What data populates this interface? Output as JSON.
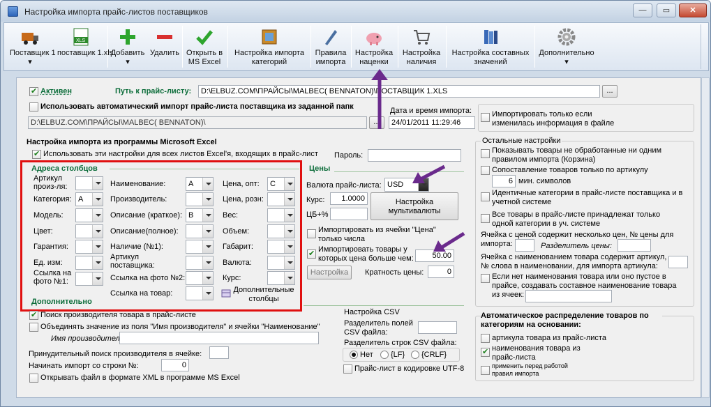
{
  "window": {
    "title": "Настройка импорта прайс-листов поставщиков"
  },
  "toolbar": {
    "supplier1": "Поставщик 1",
    "supplier2": "поставщик 1.xls",
    "add": "Добавить",
    "remove": "Удалить",
    "open_excel_1": "Открыть в",
    "open_excel_2": "MS Excel",
    "cat_import_1": "Настройка импорта",
    "cat_import_2": "категорий",
    "rules_1": "Правила",
    "rules_2": "импорта",
    "markup_1": "Настройка",
    "markup_2": "наценки",
    "avail_1": "Настройка",
    "avail_2": "наличия",
    "composite_1": "Настройка составных",
    "composite_2": "значений",
    "more": "Дополнительно"
  },
  "top": {
    "active_label": "Активен",
    "path_label": "Путь к прайс-листу:",
    "path_value": "D:\\ELBUZ.COM\\ПРАЙСЫ\\MALBEC( BENNATON)\\ПОСТАВЩИК 1.XLS",
    "browse": "...",
    "auto_import_label": "Использовать автоматический импорт прайс-листа поставщика из заданной папк",
    "auto_path": "D:\\ELBUZ.COM\\ПРАЙСЫ\\MALBEC( BENNATON)\\",
    "datetime_label": "Дата и время импорта:",
    "datetime_value": "24/01/2011 11:29:46",
    "only_if_changed": "Импортировать только если изменилась информация в файле"
  },
  "excel": {
    "title": "Настройка импорта из программы Microsoft Excel",
    "use_for_all": "Использовать эти настройки для всех листов Excel'я, входящих в прайс-лист",
    "password_label": "Пароль:"
  },
  "columns": {
    "title": "Адреса столбцов",
    "article": "Артикул произ-ля:",
    "category": "Категория:",
    "category_val": "A",
    "model": "Модель:",
    "color": "Цвет:",
    "warranty": "Гарантия:",
    "unit": "Ед. изм:",
    "photo1": "Ссылка на фото №1:",
    "name": "Наименование:",
    "name_val": "A",
    "manufacturer": "Производитель:",
    "desc_short": "Описание (краткое):",
    "desc_short_val": "B",
    "desc_full": "Описание(полное):",
    "availability": "Наличие (№1):",
    "supplier_article": "Артикул поставщика:",
    "photo2": "Ссылка на фото №2:",
    "product_link": "Ссылка на товар:",
    "price_opt": "Цена, опт:",
    "price_opt_val": "C",
    "price_retail": "Цена, розн:",
    "weight": "Вес:",
    "volume": "Объем:",
    "dimensions": "Габарит:",
    "currency": "Валюта:",
    "rate": "Курс:",
    "extra_columns": "Дополнительные столбцы"
  },
  "prices": {
    "title": "Цены",
    "currency_label": "Валюта прайс-листа:",
    "currency_value": "USD",
    "rate_label": "Курс:",
    "rate_value": "1.0000",
    "cb_label": "ЦБ+%",
    "multicurrency": "Настройка мультивалюты",
    "import_from_price": "Импортировать из ячейки \"Цена\" только числа",
    "import_above": "Импортировать товары у которых цена больше чем:",
    "above_value": "50.00",
    "settings": "Настройка",
    "multiplicity_label": "Кратность цены:",
    "multiplicity_value": "0"
  },
  "extra": {
    "title": "Дополнительно",
    "search_manufacturer": "Поиск производителя товара в прайс-листе",
    "merge_values": "Объединять значение из поля \"Имя производителя\" и ячейки \"Наименование\"",
    "manufacturer_name": "Имя производителя:",
    "forced_search": "Принудительный поиск производителя в ячейке:",
    "start_row_label": "Начинать импорт со строки №:",
    "start_row_value": "0",
    "open_xml": "Открывать файл в формате XML в программе MS Excel"
  },
  "csv": {
    "title": "Настройка CSV",
    "field_sep": "Разделитель полей CSV файла:",
    "row_sep": "Разделитель строк CSV файла:",
    "none": "Нет",
    "lf": "{LF}",
    "crlf": "{CRLF}",
    "utf8": "Прайс-лист в кодировке UTF-8"
  },
  "other": {
    "title": "Остальные настройки",
    "unprocessed": "Показывать товары не обработанные ни одним правилом импорта (Корзина)",
    "match_article": "Сопоставление товаров только по артикулу",
    "min_chars_value": "6",
    "min_chars_label": "мин. символов",
    "identical_categories": "Идентичные категории в прайс-листе поставщика и в учетной системе",
    "one_category": "Все товары в прайс-листе принадлежат только одной категории в уч. системе",
    "multi_price_1": "Ячейка с ценой содержит несколько цен, № цены для",
    "multi_price_2": "импорта:",
    "price_separator": "Разделитель цены:",
    "article_in_name_1": "Ячейка с наименованием товара содержит артикул,",
    "article_in_name_2": "№ слова в наименовании, для импорта артикула:",
    "composite_1": "Если нет наименования товара или оно пустое в",
    "composite_2": "прайсе, создавать составное наименование товара",
    "composite_3": "из ячеек:"
  },
  "autocat": {
    "title": "Автоматическое распределение товаров по категориям на основании:",
    "by_article": "артикула товара из прайс-листа",
    "by_name": "наименования товара из прайс-листа",
    "apply_before": "применить перед работой правил импорта"
  },
  "colors": {
    "accent_green": "#0c6d3a",
    "highlight_red": "#e01010",
    "arrow_purple": "#6a2a8c"
  }
}
